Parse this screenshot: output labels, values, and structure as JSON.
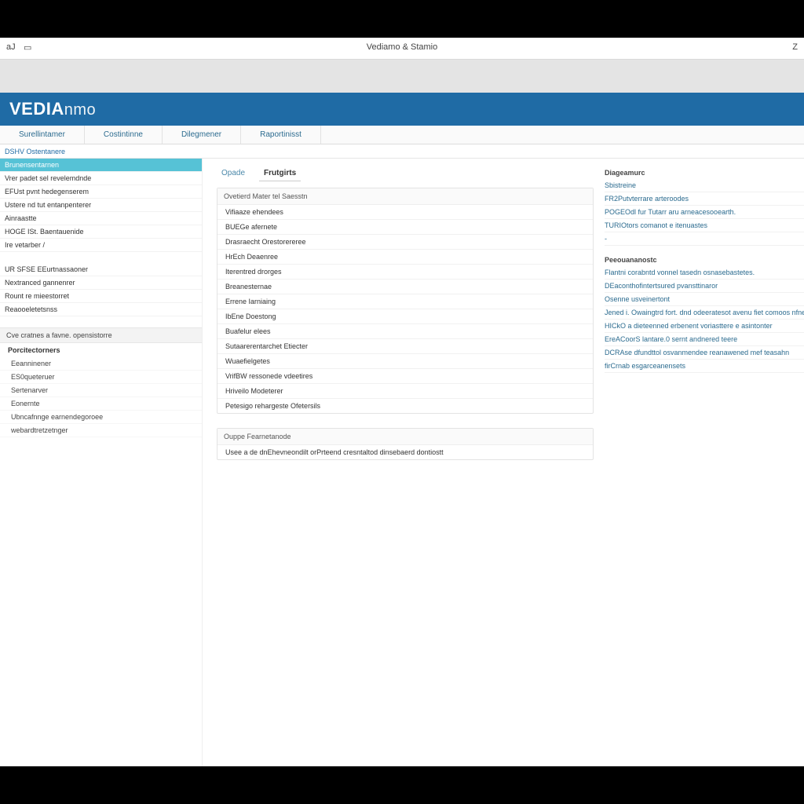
{
  "window": {
    "title": "Vediamo & Stamio",
    "icon1": "aJ",
    "icon2": "▭",
    "close": "Z"
  },
  "brand": {
    "strong": "VEDIA",
    "light": "nmo"
  },
  "menu": [
    "Surellintamer",
    "Costintinne",
    "Dilegmener",
    "Raportinisst"
  ],
  "breadcrumb": "DSHV Ostentanere",
  "sidebar": {
    "groupA": [
      {
        "label": "Brunensentarnen",
        "active": true
      },
      {
        "label": "Vrer padet sel revelemdnde"
      },
      {
        "label": "EFUst pvnt hedegenserem"
      },
      {
        "label": "Ustere nd tut entanpenterer"
      },
      {
        "label": "Ainraastte"
      },
      {
        "label": "HOGE ISt. Baentauenide"
      },
      {
        "label": "Ire vetarber /"
      }
    ],
    "groupB": [
      {
        "label": "UR SFSE EEurtnassaoner"
      },
      {
        "label": "Nextranced gannenrer"
      },
      {
        "label": "Rount re mieestorret"
      },
      {
        "label": "Reaooeletetsnss"
      }
    ],
    "subhead": "Cve cratnes a favne. opensistorre",
    "section": "Porcitectorners",
    "subs": [
      "Eeanninener",
      "ES0queteruer",
      "Sertenarver",
      "Eonernte",
      "Ubncafnnge earnendegoroee",
      "webardtretzetnger"
    ]
  },
  "tabs": [
    {
      "label": "Opade",
      "active": false
    },
    {
      "label": "Frutgirts",
      "active": true
    }
  ],
  "centerPanels": [
    {
      "head": "Ovetierd Mater tel Saesstn",
      "rows": [
        "Vifiaaze ehendees",
        "BUEGe afernete",
        "Drasraecht Orestorereree",
        "HrEch Deaenree",
        "Iterentred drorges",
        "Breanesternae",
        "Errene Iarniaing",
        "IbEne Doestong",
        "Buafelur elees",
        "Sutaarerentarchet Etiecter",
        "Wuaefielgetes",
        "VrifBW ressonede vdeetires",
        "Hriveilo Modeterer",
        "Petesigo rehargeste Ofetersils"
      ]
    },
    {
      "head": "Ouppe Fearnetanode",
      "rows": [
        "Usee a de dnEhevneondilt orPrteend cresntaltod dinsebaerd dontiostt"
      ]
    }
  ],
  "right": {
    "sections": [
      {
        "head": "Diageamurc",
        "rows": [
          "Sbistreine",
          "FR2Putvterrare arteroodes",
          "POGEOdl fur Tutarr aru arneacesooearth.",
          "TURIOtors comanot e itenuastes",
          "-"
        ]
      },
      {
        "head": "Peeouananostc",
        "rows": [
          "Flantni corabntd vonnel tasedn osnasebastetes.",
          "DEaconthofintertsured pvansttinaror",
          "Osenne usveinertont",
          "Jened i. Owaingtrd fort. dnd odeeratesot avenu fiet comoos nfner",
          "HICkO a dieteenned erbenent voriasttere e asintonter",
          "EreACoorS lantare.0 sernt andnered teere",
          "DCRAse dfundttol osvanmendee reanawened mef teasahn",
          "firCrnab esgarceanensets"
        ]
      }
    ]
  }
}
